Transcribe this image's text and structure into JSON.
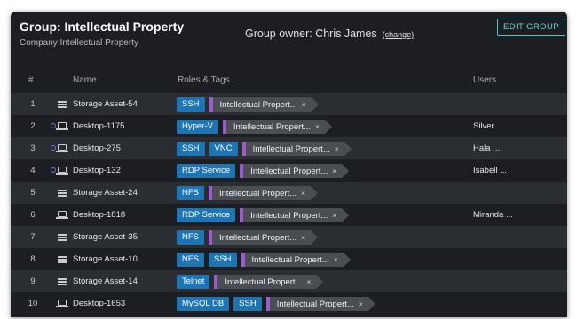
{
  "header": {
    "title": "Group: Intellectual Property",
    "subtitle": "Company Intellectual Property",
    "owner_text": "Group owner: Chris James",
    "change_link": "(change)",
    "edit_button": "EDIT GROUP"
  },
  "columns": {
    "num": "#",
    "name": "Name",
    "roles": "Roles & Tags",
    "users": "Users"
  },
  "ip_tag_label": "Intellectual Propert...",
  "close_glyph": "×",
  "rows": [
    {
      "num": "1",
      "icon": "storage-icon",
      "online": false,
      "name": "Storage Asset-54",
      "roles": [
        "SSH"
      ],
      "users": ""
    },
    {
      "num": "2",
      "icon": "desktop-icon",
      "online": true,
      "name": "Desktop-1175",
      "roles": [
        "Hyper-V"
      ],
      "users": "Silver ..."
    },
    {
      "num": "3",
      "icon": "desktop-icon",
      "online": true,
      "name": "Desktop-275",
      "roles": [
        "SSH",
        "VNC"
      ],
      "users": "Hala ..."
    },
    {
      "num": "4",
      "icon": "desktop-icon",
      "online": true,
      "name": "Desktop-132",
      "roles": [
        "RDP Service"
      ],
      "users": "Isabell ..."
    },
    {
      "num": "5",
      "icon": "storage-icon",
      "online": false,
      "name": "Storage Asset-24",
      "roles": [
        "NFS"
      ],
      "users": ""
    },
    {
      "num": "6",
      "icon": "desktop-icon",
      "online": false,
      "name": "Desktop-1818",
      "roles": [
        "RDP Service"
      ],
      "users": "Miranda ..."
    },
    {
      "num": "7",
      "icon": "storage-icon",
      "online": false,
      "name": "Storage Asset-35",
      "roles": [
        "NFS"
      ],
      "users": ""
    },
    {
      "num": "8",
      "icon": "storage-icon",
      "online": false,
      "name": "Storage Asset-10",
      "roles": [
        "NFS",
        "SSH"
      ],
      "users": ""
    },
    {
      "num": "9",
      "icon": "storage-icon",
      "online": false,
      "name": "Storage Asset-14",
      "roles": [
        "Telnet"
      ],
      "users": ""
    },
    {
      "num": "10",
      "icon": "desktop-icon",
      "online": false,
      "name": "Desktop-1653",
      "roles": [
        "MySQL DB",
        "SSH"
      ],
      "users": ""
    }
  ]
}
